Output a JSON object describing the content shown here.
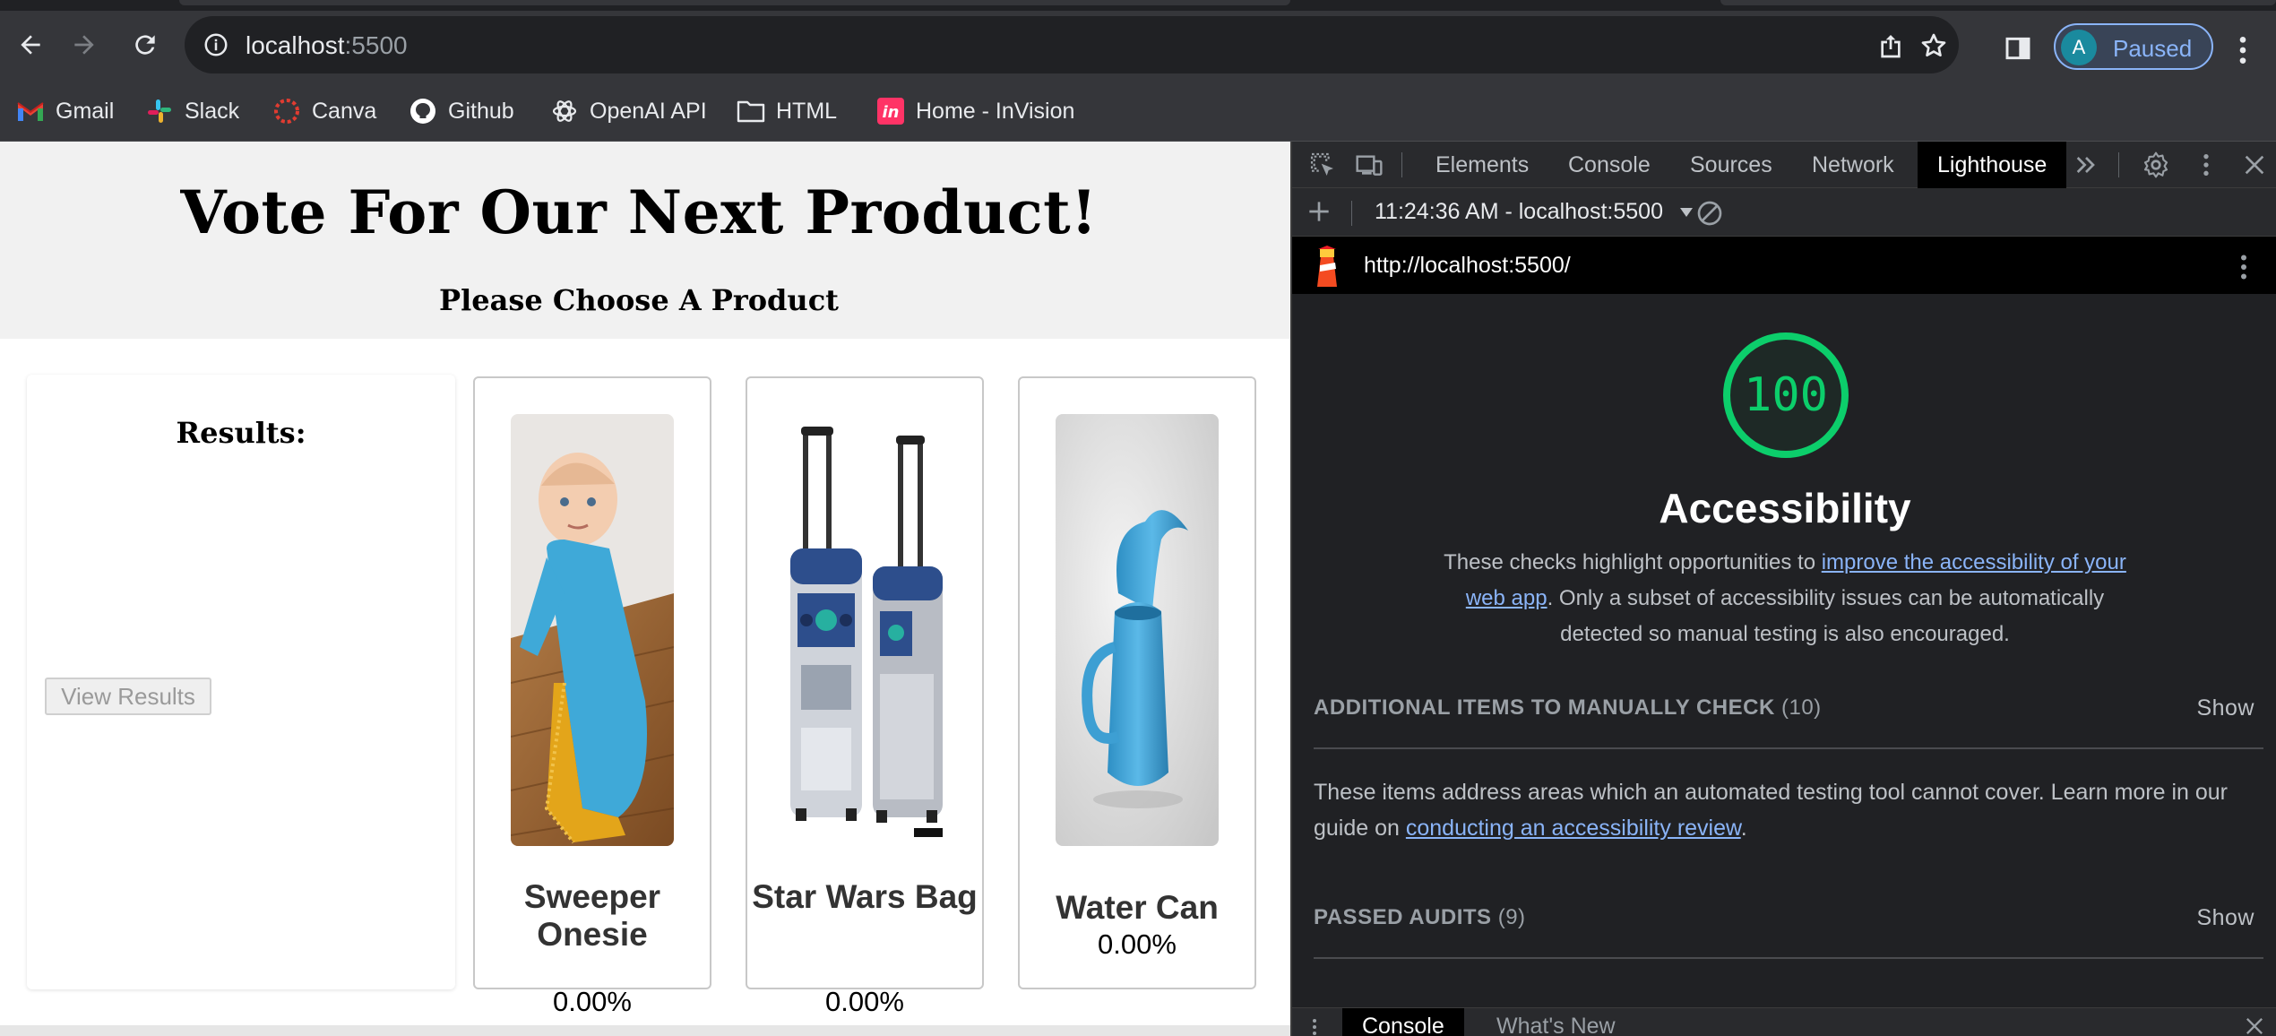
{
  "browser": {
    "url_host": "localhost",
    "url_port": ":5500",
    "profile_initial": "A",
    "profile_status": "Paused"
  },
  "bookmarks": [
    {
      "label": "Gmail",
      "icon": "gmail-icon"
    },
    {
      "label": "Slack",
      "icon": "slack-icon"
    },
    {
      "label": "Canva",
      "icon": "canva-icon"
    },
    {
      "label": "Github",
      "icon": "github-icon"
    },
    {
      "label": "OpenAI API",
      "icon": "openai-icon"
    },
    {
      "label": "HTML",
      "icon": "folder-icon"
    },
    {
      "label": "Home - InVision",
      "icon": "invision-icon"
    }
  ],
  "page": {
    "title": "Vote For Our Next Product!",
    "subtitle": "Please Choose A Product",
    "results_title": "Results:",
    "view_results_label": "View Results",
    "products": [
      {
        "name": "Sweeper Onesie",
        "percent": "0.00%",
        "image": "baby-onesie-image"
      },
      {
        "name": "Star Wars Bag",
        "percent": "0.00%",
        "image": "r2d2-luggage-image"
      },
      {
        "name": "Water Can",
        "percent": "0.00%",
        "image": "watering-can-image"
      }
    ]
  },
  "devtools": {
    "tabs": [
      "Elements",
      "Console",
      "Sources",
      "Network",
      "Lighthouse"
    ],
    "active_tab": "Lighthouse",
    "report_label": "11:24:36 AM - localhost:5500",
    "audited_url": "http://localhost:5500/",
    "score": "100",
    "score_fraction": 1.0,
    "score_color": "#0cce6b",
    "category": "Accessibility",
    "description_before": "These checks highlight opportunities to ",
    "description_link": "improve the accessibility of your web app",
    "description_after": ". Only a subset of accessibility issues can be automatically detected so manual testing is also encouraged.",
    "manual_heading": "Additional items to manually check",
    "manual_count": "(10)",
    "manual_show": "Show",
    "manual_text_before": "These items address areas which an automated testing tool cannot cover. Learn more in our guide on ",
    "manual_link": "conducting an accessibility review",
    "manual_text_after": ".",
    "passed_heading": "Passed audits",
    "passed_count": "(9)",
    "passed_show": "Show",
    "drawer_tabs": [
      "Console",
      "What's New"
    ]
  }
}
